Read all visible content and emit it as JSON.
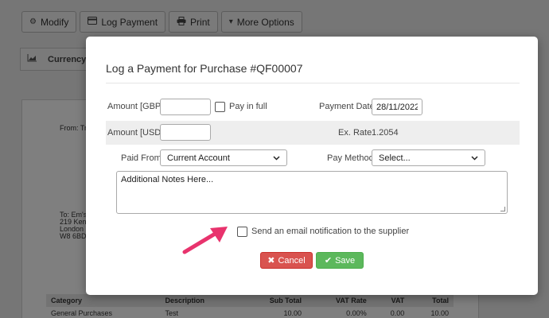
{
  "toolbar": {
    "modify": "Modify",
    "log_payment": "Log Payment",
    "print": "Print",
    "more_options": "More Options"
  },
  "currency_tab": "Currency",
  "document": {
    "from_prefix": "From: Tr",
    "to_lines": [
      "To: Em's",
      "219 Ken",
      "London",
      "W8 6BD"
    ],
    "table": {
      "headers": [
        "Category",
        "Description",
        "Sub Total",
        "VAT Rate",
        "VAT",
        "Total"
      ],
      "rows": [
        [
          "General Purchases",
          "Test",
          "10.00",
          "0.00%",
          "0.00",
          "10.00"
        ]
      ]
    }
  },
  "modal": {
    "title": "Log a Payment for Purchase #QF00007",
    "amount_gbp_label": "Amount [GBP]",
    "amount_gbp_value": "",
    "pay_in_full_label": "Pay in full",
    "payment_date_label": "Payment Date",
    "payment_date_value": "28/11/2022",
    "amount_usd_label": "Amount [USD]",
    "amount_usd_value": "",
    "ex_rate_label": "Ex. Rate",
    "ex_rate_value": "1.2054",
    "paid_from_label": "Paid From",
    "paid_from_value": "Current Account",
    "pay_method_label": "Pay Method",
    "pay_method_value": "Select...",
    "notes_value": "Additional Notes Here...",
    "email_notification_label": "Send an email notification to the supplier",
    "cancel_label": "Cancel",
    "save_label": "Save"
  },
  "colors": {
    "cancel": "#d9534f",
    "save": "#5cb85c",
    "arrow": "#e8336d"
  }
}
